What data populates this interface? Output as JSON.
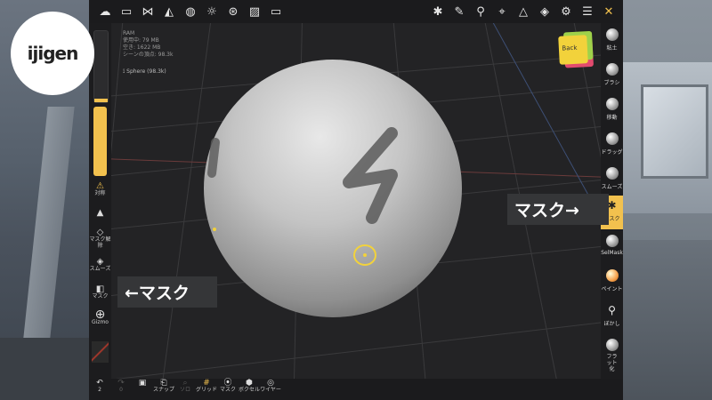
{
  "logo_text": "ijigen",
  "stats": {
    "line1": "RAM",
    "line2": "使用中: 79 MB",
    "line3": "空き: 1622 MB",
    "line4": "シーンの頂点: 98.3k"
  },
  "object_label": "Sphere (98.3k)",
  "view_cube_label": "Back",
  "top_icons_left": [
    "menu-icon",
    "folder-icon",
    "share-icon",
    "scene-icon",
    "globe-icon",
    "sun-icon",
    "material-icon",
    "image-icon",
    "video-icon"
  ],
  "top_icons_right": [
    "mask-tool-icon",
    "pen-icon",
    "eyedropper-icon",
    "tool-icon",
    "triangle-icon",
    "layers-icon",
    "settings-icon",
    "sliders-icon",
    "tools-icon"
  ],
  "left_panel": {
    "items": [
      {
        "label": "対称",
        "icon": "⚠"
      },
      {
        "label": "",
        "icon": "▲"
      },
      {
        "label": "マスク解除",
        "icon": "◇"
      },
      {
        "label": "スムーズ",
        "icon": "◈"
      },
      {
        "label": "マスク",
        "icon": "◧"
      },
      {
        "label": "Gizmo",
        "icon": "⊕"
      }
    ]
  },
  "right_panel": {
    "items": [
      {
        "label": "粘土"
      },
      {
        "label": "ブラシ"
      },
      {
        "label": "移動"
      },
      {
        "label": "ドラッグ"
      },
      {
        "label": "スムーズ"
      },
      {
        "label": "マスク"
      },
      {
        "label": "SelMask"
      },
      {
        "label": "ペイント"
      },
      {
        "label": "ぼかし"
      },
      {
        "label": "フラット化"
      }
    ],
    "active": "マスク"
  },
  "bottom_bar": [
    {
      "label": "2",
      "icon": "↶"
    },
    {
      "label": "0",
      "icon": "↷"
    },
    {
      "label": "",
      "icon": "▣"
    },
    {
      "label": "スナップ",
      "icon": "⎗"
    },
    {
      "label": "ソロ",
      "icon": "⌕"
    },
    {
      "label": "グリッド",
      "icon": "#"
    },
    {
      "label": "マスク",
      "icon": "⦿"
    },
    {
      "label": "ボクセル",
      "icon": "⬢"
    },
    {
      "label": "ワイヤー",
      "icon": "◎"
    }
  ],
  "callouts": {
    "left": "←マスク",
    "right": "マスク→"
  },
  "colors": {
    "accent": "#f2c14e",
    "panel": "#1c1c1e",
    "viewport": "#232325",
    "sphere": "#bcbcbc"
  }
}
